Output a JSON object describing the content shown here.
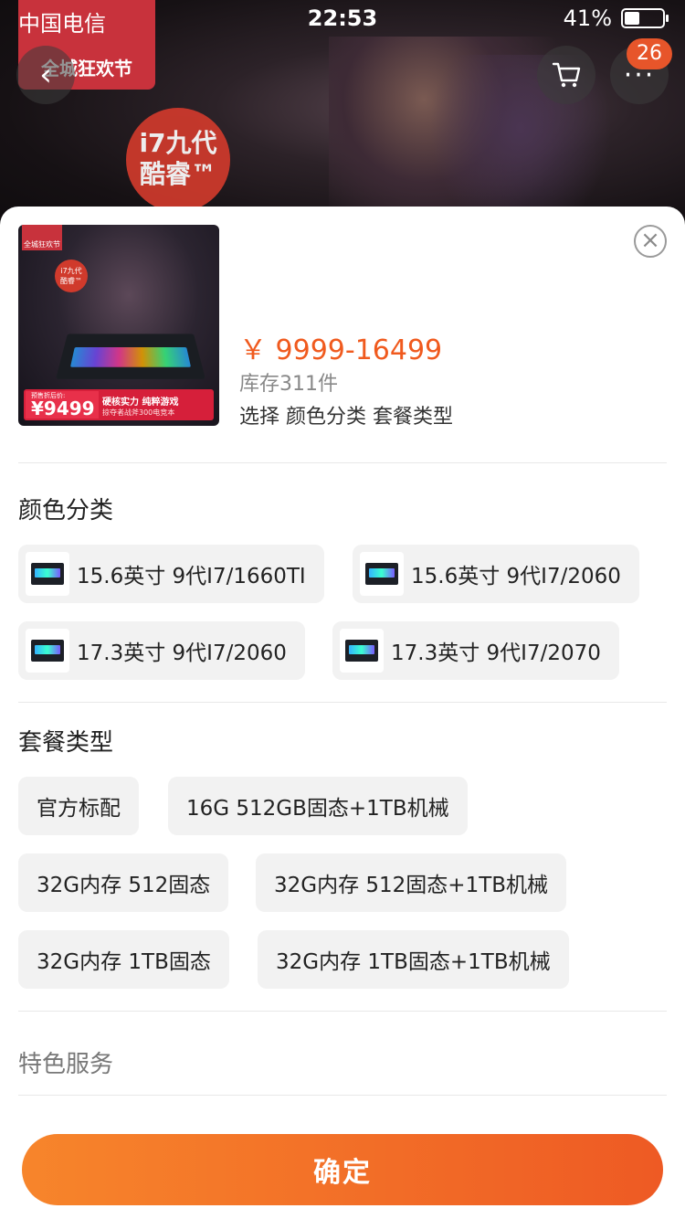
{
  "status_bar": {
    "carrier": "中国电信",
    "time": "22:53",
    "battery": "41%"
  },
  "background": {
    "promo_badge": "全城狂欢节",
    "chip_label_1": "i7九代",
    "chip_label_2": "酷睿™"
  },
  "header": {
    "back_icon": "‹",
    "cart_icon": "🛒",
    "more_icon": "···",
    "more_count": "26"
  },
  "product": {
    "price": "￥ 9999-16499",
    "stock": "库存311件",
    "select_hint": "选择  颜色分类 套餐类型",
    "thumb": {
      "badge": "全城狂欢节",
      "i7_line1": "i7九代",
      "i7_line2": "酷睿™",
      "price_label": "预售折后价:",
      "price_value": "¥9499",
      "banner_line1": "硬核实力 纯粹游戏",
      "banner_line2": "掠夺者战斧300电竞本"
    }
  },
  "color_section": {
    "title": "颜色分类",
    "options": [
      "15.6英寸 9代I7/1660TI",
      "15.6英寸 9代I7/2060",
      "17.3英寸 9代I7/2060",
      "17.3英寸 9代I7/2070"
    ]
  },
  "package_section": {
    "title": "套餐类型",
    "options": [
      "官方标配",
      "16G 512GB固态+1TB机械",
      "32G内存 512固态",
      "32G内存 512固态+1TB机械",
      "32G内存 1TB固态",
      "32G内存 1TB固态+1TB机械"
    ]
  },
  "service_section": {
    "title": "特色服务"
  },
  "close_icon": "×",
  "confirm_label": "确定"
}
